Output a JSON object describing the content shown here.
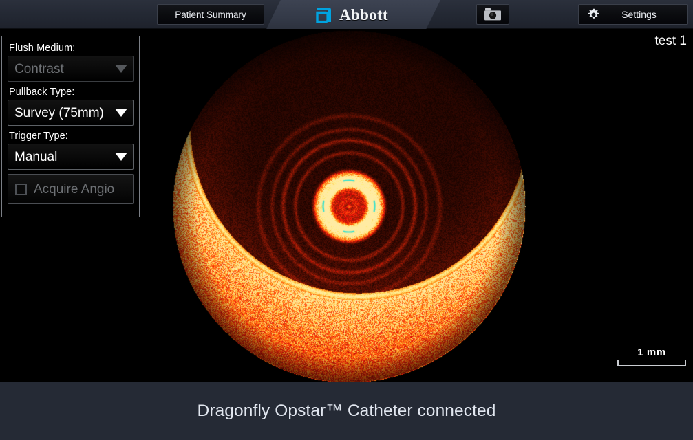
{
  "topbar": {
    "patient_summary_label": "Patient Summary",
    "brand_name": "Abbott",
    "capture_icon": "camera-icon",
    "settings_icon": "gear-icon",
    "settings_label": "Settings",
    "brand_color": "#00a3e0",
    "bar_color": "#242832",
    "trapezoid_color": "#363c4a"
  },
  "control_panel": {
    "flush_medium": {
      "label": "Flush Medium:",
      "value": "Contrast",
      "enabled": false
    },
    "pullback_type": {
      "label": "Pullback Type:",
      "value": "Survey (75mm)",
      "enabled": true
    },
    "trigger_type": {
      "label": "Trigger Type:",
      "value": "Manual",
      "enabled": true
    },
    "acquire_angio": {
      "label": "Acquire Angio",
      "checked": false,
      "enabled": false
    }
  },
  "image_view": {
    "session_label": "test 1",
    "scale_label": "1 mm",
    "modality": "oct-cross-section",
    "background_color": "#000000",
    "tissue_color": "#ff9a1f",
    "marker_color": "#33e0d0"
  },
  "status_bar": {
    "message": "Dragonfly Opstar™ Catheter connected",
    "background_color": "#252a35",
    "text_color": "#e2e7f0"
  }
}
